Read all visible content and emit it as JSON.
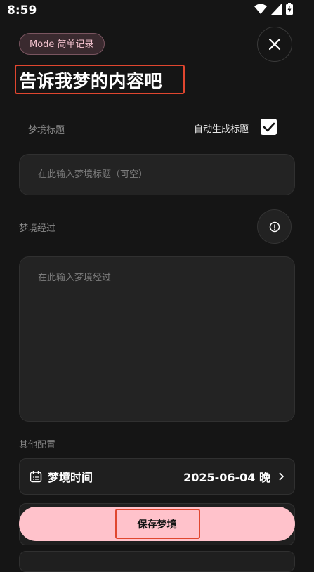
{
  "status_bar": {
    "time": "8:59"
  },
  "header": {
    "mode_pill": "Mode 简单记录",
    "title": "告诉我梦的内容吧"
  },
  "dream_title": {
    "label": "梦境标题",
    "auto_generate_label": "自动生成标题",
    "auto_generate_checked": true,
    "placeholder": "在此输入梦境标题（可空）"
  },
  "dream_content": {
    "label": "梦境经过",
    "placeholder": "在此输入梦境经过"
  },
  "other_config": {
    "label": "其他配置",
    "time_row": {
      "label": "梦境时间",
      "value": "2025-06-04 晚"
    }
  },
  "save_button": {
    "label": "保存梦境"
  },
  "colors": {
    "accent_pink": "#ffc2cb",
    "highlight_red": "#e0462f",
    "background": "#151515"
  }
}
